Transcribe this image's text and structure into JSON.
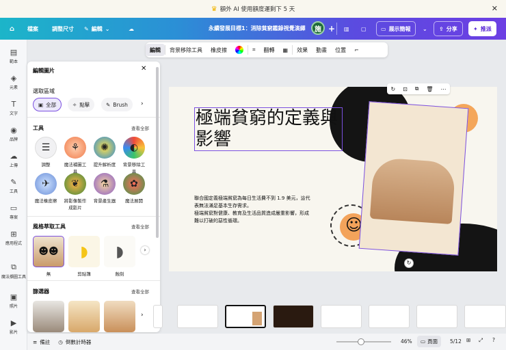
{
  "banner": {
    "text": "額外 AI 使用額度運剩下 5 天"
  },
  "topbar": {
    "home": "首頁",
    "file": "檔案",
    "resize": "調整尺寸",
    "edit": "編輯",
    "doc_title": "永續發展目標1：消除貧窮鑑錄視覺演繹",
    "avatar": "施",
    "present": "展示簡報",
    "share": "分享",
    "push": "推派"
  },
  "rail": {
    "items": [
      "範本",
      "元素",
      "文字",
      "品牌",
      "上傳",
      "工具",
      "專案",
      "應用程式",
      "魔法擷圖工具",
      "照片",
      "影片"
    ]
  },
  "context_toolbar": {
    "edit": "編輯",
    "bg_remove": "背景移除工具",
    "eraser": "橡皮擦",
    "flip": "翻轉",
    "effects": "效果",
    "animate": "動畫",
    "position": "位置"
  },
  "panel": {
    "title": "編輯圖片",
    "select_area": "選取區域",
    "chips": [
      "全部",
      "點擊",
      "Brush"
    ],
    "tools_title": "工具",
    "see_all": "查看全部",
    "tools": [
      "調整",
      "魔法補圖工具",
      "提升解析度",
      "背景移除工具",
      "魔法橡皮擦",
      "將影像製作成影片",
      "背景產生器",
      "魔法展開"
    ],
    "style_title": "風格萃取工具",
    "styles": [
      "無",
      "剪貼簿",
      "蝕刻"
    ],
    "filter_title": "篩選器"
  },
  "slide": {
    "headline": "極端貧窮的定義與影響",
    "body_lines": [
      "聯合國定義極端貧窮為每日生活費不到 1.9 美元，這代",
      "表無法滿足基本生存需求。",
      "極端貧窮對健康、教育及生活品質造成嚴重影響，形成",
      "難以打破的惡性循環。"
    ]
  },
  "status": {
    "notes": "備註",
    "timer": "倒數計時器",
    "zoom": "46%",
    "view": "頁面",
    "page": "5/12"
  },
  "colors": {
    "accent": "#7b4fe0",
    "topbar_start": "#1cb5c9",
    "topbar_end": "#6c3fe3"
  }
}
